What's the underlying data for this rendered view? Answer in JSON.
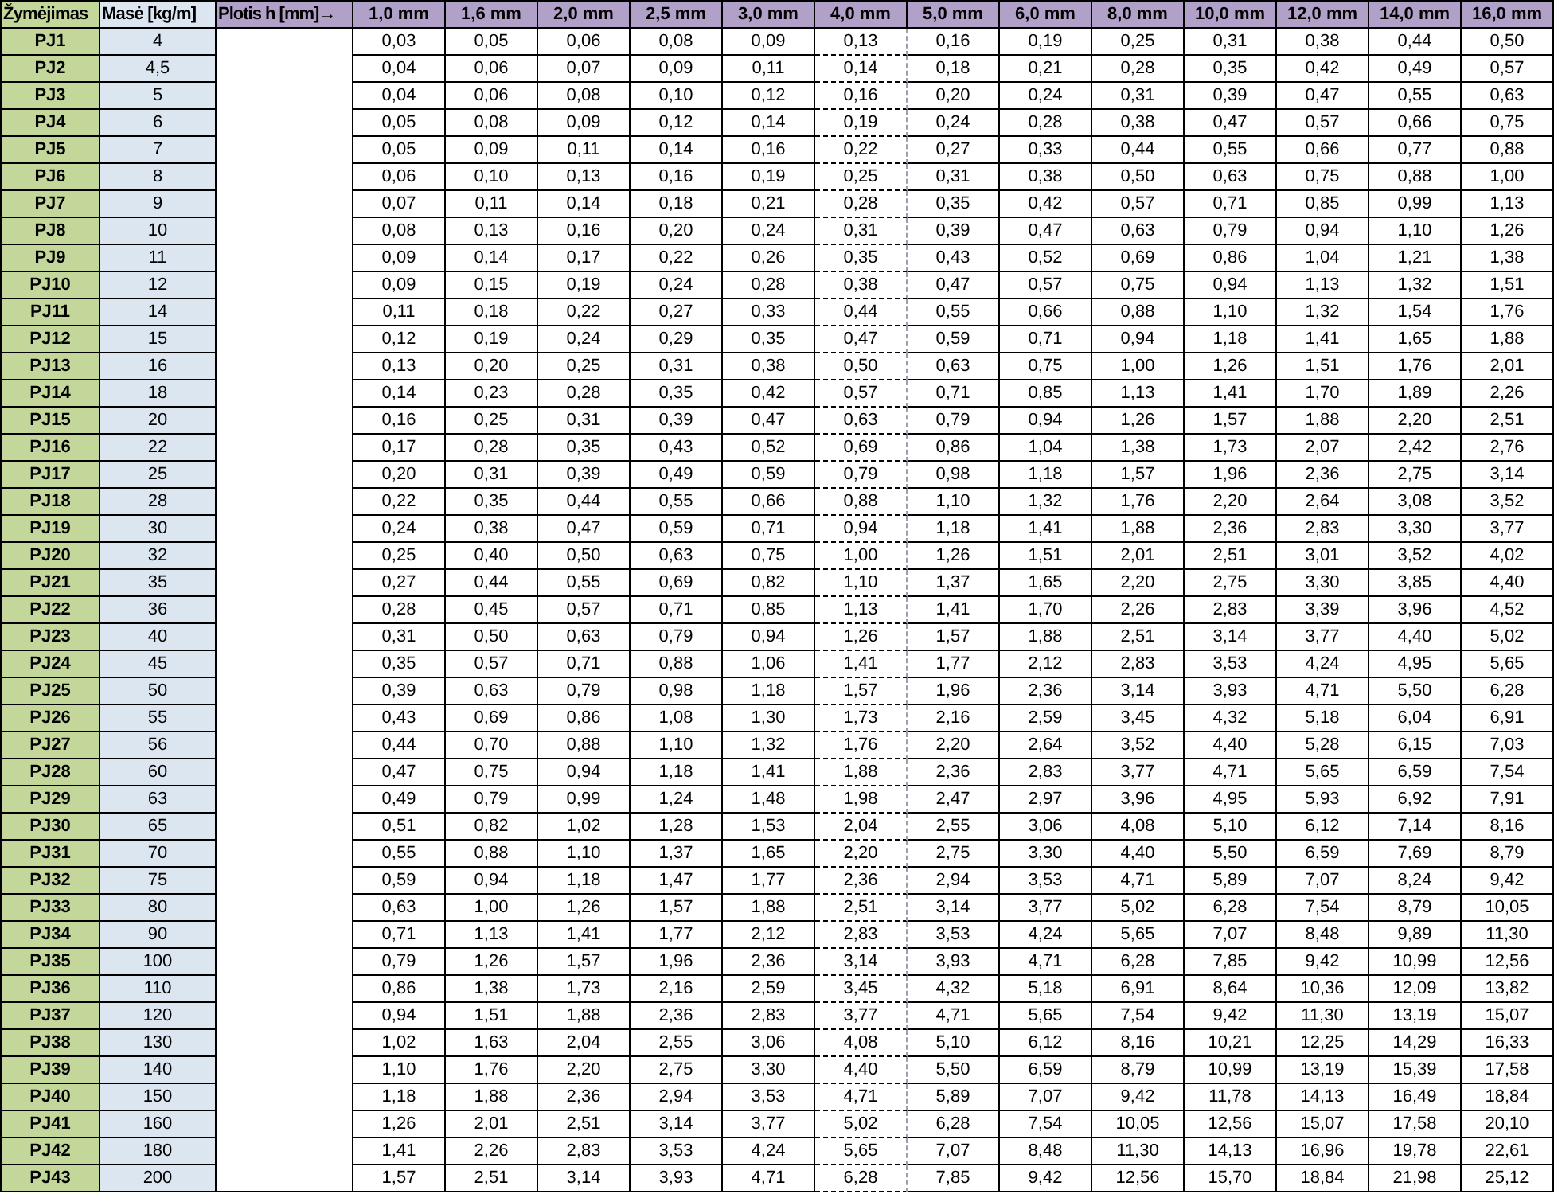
{
  "table": {
    "columns": [
      {
        "label": "Žymėjimas",
        "kind": "designation"
      },
      {
        "label": "Masė [kg/m]",
        "kind": "mass"
      },
      {
        "label": "Plotis h [mm]→",
        "kind": "width"
      },
      {
        "label": "1,0 mm",
        "kind": "thickness"
      },
      {
        "label": "1,6 mm",
        "kind": "thickness"
      },
      {
        "label": "2,0 mm",
        "kind": "thickness"
      },
      {
        "label": "2,5 mm",
        "kind": "thickness"
      },
      {
        "label": "3,0 mm",
        "kind": "thickness"
      },
      {
        "label": "4,0 mm",
        "kind": "thickness"
      },
      {
        "label": "5,0 mm",
        "kind": "thickness"
      },
      {
        "label": "6,0 mm",
        "kind": "thickness"
      },
      {
        "label": "8,0 mm",
        "kind": "thickness"
      },
      {
        "label": "10,0 mm",
        "kind": "thickness"
      },
      {
        "label": "12,0 mm",
        "kind": "thickness"
      },
      {
        "label": "14,0 mm",
        "kind": "thickness"
      },
      {
        "label": "16,0 mm",
        "kind": "thickness"
      }
    ],
    "rows": [
      [
        "PJ1",
        "4",
        "",
        "0,03",
        "0,05",
        "0,06",
        "0,08",
        "0,09",
        "0,13",
        "0,16",
        "0,19",
        "0,25",
        "0,31",
        "0,38",
        "0,44",
        "0,50"
      ],
      [
        "PJ2",
        "4,5",
        "",
        "0,04",
        "0,06",
        "0,07",
        "0,09",
        "0,11",
        "0,14",
        "0,18",
        "0,21",
        "0,28",
        "0,35",
        "0,42",
        "0,49",
        "0,57"
      ],
      [
        "PJ3",
        "5",
        "",
        "0,04",
        "0,06",
        "0,08",
        "0,10",
        "0,12",
        "0,16",
        "0,20",
        "0,24",
        "0,31",
        "0,39",
        "0,47",
        "0,55",
        "0,63"
      ],
      [
        "PJ4",
        "6",
        "",
        "0,05",
        "0,08",
        "0,09",
        "0,12",
        "0,14",
        "0,19",
        "0,24",
        "0,28",
        "0,38",
        "0,47",
        "0,57",
        "0,66",
        "0,75"
      ],
      [
        "PJ5",
        "7",
        "",
        "0,05",
        "0,09",
        "0,11",
        "0,14",
        "0,16",
        "0,22",
        "0,27",
        "0,33",
        "0,44",
        "0,55",
        "0,66",
        "0,77",
        "0,88"
      ],
      [
        "PJ6",
        "8",
        "",
        "0,06",
        "0,10",
        "0,13",
        "0,16",
        "0,19",
        "0,25",
        "0,31",
        "0,38",
        "0,50",
        "0,63",
        "0,75",
        "0,88",
        "1,00"
      ],
      [
        "PJ7",
        "9",
        "",
        "0,07",
        "0,11",
        "0,14",
        "0,18",
        "0,21",
        "0,28",
        "0,35",
        "0,42",
        "0,57",
        "0,71",
        "0,85",
        "0,99",
        "1,13"
      ],
      [
        "PJ8",
        "10",
        "",
        "0,08",
        "0,13",
        "0,16",
        "0,20",
        "0,24",
        "0,31",
        "0,39",
        "0,47",
        "0,63",
        "0,79",
        "0,94",
        "1,10",
        "1,26"
      ],
      [
        "PJ9",
        "11",
        "",
        "0,09",
        "0,14",
        "0,17",
        "0,22",
        "0,26",
        "0,35",
        "0,43",
        "0,52",
        "0,69",
        "0,86",
        "1,04",
        "1,21",
        "1,38"
      ],
      [
        "PJ10",
        "12",
        "",
        "0,09",
        "0,15",
        "0,19",
        "0,24",
        "0,28",
        "0,38",
        "0,47",
        "0,57",
        "0,75",
        "0,94",
        "1,13",
        "1,32",
        "1,51"
      ],
      [
        "PJ11",
        "14",
        "",
        "0,11",
        "0,18",
        "0,22",
        "0,27",
        "0,33",
        "0,44",
        "0,55",
        "0,66",
        "0,88",
        "1,10",
        "1,32",
        "1,54",
        "1,76"
      ],
      [
        "PJ12",
        "15",
        "",
        "0,12",
        "0,19",
        "0,24",
        "0,29",
        "0,35",
        "0,47",
        "0,59",
        "0,71",
        "0,94",
        "1,18",
        "1,41",
        "1,65",
        "1,88"
      ],
      [
        "PJ13",
        "16",
        "",
        "0,13",
        "0,20",
        "0,25",
        "0,31",
        "0,38",
        "0,50",
        "0,63",
        "0,75",
        "1,00",
        "1,26",
        "1,51",
        "1,76",
        "2,01"
      ],
      [
        "PJ14",
        "18",
        "",
        "0,14",
        "0,23",
        "0,28",
        "0,35",
        "0,42",
        "0,57",
        "0,71",
        "0,85",
        "1,13",
        "1,41",
        "1,70",
        "1,89",
        "2,26"
      ],
      [
        "PJ15",
        "20",
        "",
        "0,16",
        "0,25",
        "0,31",
        "0,39",
        "0,47",
        "0,63",
        "0,79",
        "0,94",
        "1,26",
        "1,57",
        "1,88",
        "2,20",
        "2,51"
      ],
      [
        "PJ16",
        "22",
        "",
        "0,17",
        "0,28",
        "0,35",
        "0,43",
        "0,52",
        "0,69",
        "0,86",
        "1,04",
        "1,38",
        "1,73",
        "2,07",
        "2,42",
        "2,76"
      ],
      [
        "PJ17",
        "25",
        "",
        "0,20",
        "0,31",
        "0,39",
        "0,49",
        "0,59",
        "0,79",
        "0,98",
        "1,18",
        "1,57",
        "1,96",
        "2,36",
        "2,75",
        "3,14"
      ],
      [
        "PJ18",
        "28",
        "",
        "0,22",
        "0,35",
        "0,44",
        "0,55",
        "0,66",
        "0,88",
        "1,10",
        "1,32",
        "1,76",
        "2,20",
        "2,64",
        "3,08",
        "3,52"
      ],
      [
        "PJ19",
        "30",
        "",
        "0,24",
        "0,38",
        "0,47",
        "0,59",
        "0,71",
        "0,94",
        "1,18",
        "1,41",
        "1,88",
        "2,36",
        "2,83",
        "3,30",
        "3,77"
      ],
      [
        "PJ20",
        "32",
        "",
        "0,25",
        "0,40",
        "0,50",
        "0,63",
        "0,75",
        "1,00",
        "1,26",
        "1,51",
        "2,01",
        "2,51",
        "3,01",
        "3,52",
        "4,02"
      ],
      [
        "PJ21",
        "35",
        "",
        "0,27",
        "0,44",
        "0,55",
        "0,69",
        "0,82",
        "1,10",
        "1,37",
        "1,65",
        "2,20",
        "2,75",
        "3,30",
        "3,85",
        "4,40"
      ],
      [
        "PJ22",
        "36",
        "",
        "0,28",
        "0,45",
        "0,57",
        "0,71",
        "0,85",
        "1,13",
        "1,41",
        "1,70",
        "2,26",
        "2,83",
        "3,39",
        "3,96",
        "4,52"
      ],
      [
        "PJ23",
        "40",
        "",
        "0,31",
        "0,50",
        "0,63",
        "0,79",
        "0,94",
        "1,26",
        "1,57",
        "1,88",
        "2,51",
        "3,14",
        "3,77",
        "4,40",
        "5,02"
      ],
      [
        "PJ24",
        "45",
        "",
        "0,35",
        "0,57",
        "0,71",
        "0,88",
        "1,06",
        "1,41",
        "1,77",
        "2,12",
        "2,83",
        "3,53",
        "4,24",
        "4,95",
        "5,65"
      ],
      [
        "PJ25",
        "50",
        "",
        "0,39",
        "0,63",
        "0,79",
        "0,98",
        "1,18",
        "1,57",
        "1,96",
        "2,36",
        "3,14",
        "3,93",
        "4,71",
        "5,50",
        "6,28"
      ],
      [
        "PJ26",
        "55",
        "",
        "0,43",
        "0,69",
        "0,86",
        "1,08",
        "1,30",
        "1,73",
        "2,16",
        "2,59",
        "3,45",
        "4,32",
        "5,18",
        "6,04",
        "6,91"
      ],
      [
        "PJ27",
        "56",
        "",
        "0,44",
        "0,70",
        "0,88",
        "1,10",
        "1,32",
        "1,76",
        "2,20",
        "2,64",
        "3,52",
        "4,40",
        "5,28",
        "6,15",
        "7,03"
      ],
      [
        "PJ28",
        "60",
        "",
        "0,47",
        "0,75",
        "0,94",
        "1,18",
        "1,41",
        "1,88",
        "2,36",
        "2,83",
        "3,77",
        "4,71",
        "5,65",
        "6,59",
        "7,54"
      ],
      [
        "PJ29",
        "63",
        "",
        "0,49",
        "0,79",
        "0,99",
        "1,24",
        "1,48",
        "1,98",
        "2,47",
        "2,97",
        "3,96",
        "4,95",
        "5,93",
        "6,92",
        "7,91"
      ],
      [
        "PJ30",
        "65",
        "",
        "0,51",
        "0,82",
        "1,02",
        "1,28",
        "1,53",
        "2,04",
        "2,55",
        "3,06",
        "4,08",
        "5,10",
        "6,12",
        "7,14",
        "8,16"
      ],
      [
        "PJ31",
        "70",
        "",
        "0,55",
        "0,88",
        "1,10",
        "1,37",
        "1,65",
        "2,20",
        "2,75",
        "3,30",
        "4,40",
        "5,50",
        "6,59",
        "7,69",
        "8,79"
      ],
      [
        "PJ32",
        "75",
        "",
        "0,59",
        "0,94",
        "1,18",
        "1,47",
        "1,77",
        "2,36",
        "2,94",
        "3,53",
        "4,71",
        "5,89",
        "7,07",
        "8,24",
        "9,42"
      ],
      [
        "PJ33",
        "80",
        "",
        "0,63",
        "1,00",
        "1,26",
        "1,57",
        "1,88",
        "2,51",
        "3,14",
        "3,77",
        "5,02",
        "6,28",
        "7,54",
        "8,79",
        "10,05"
      ],
      [
        "PJ34",
        "90",
        "",
        "0,71",
        "1,13",
        "1,41",
        "1,77",
        "2,12",
        "2,83",
        "3,53",
        "4,24",
        "5,65",
        "7,07",
        "8,48",
        "9,89",
        "11,30"
      ],
      [
        "PJ35",
        "100",
        "",
        "0,79",
        "1,26",
        "1,57",
        "1,96",
        "2,36",
        "3,14",
        "3,93",
        "4,71",
        "6,28",
        "7,85",
        "9,42",
        "10,99",
        "12,56"
      ],
      [
        "PJ36",
        "110",
        "",
        "0,86",
        "1,38",
        "1,73",
        "2,16",
        "2,59",
        "3,45",
        "4,32",
        "5,18",
        "6,91",
        "8,64",
        "10,36",
        "12,09",
        "13,82"
      ],
      [
        "PJ37",
        "120",
        "",
        "0,94",
        "1,51",
        "1,88",
        "2,36",
        "2,83",
        "3,77",
        "4,71",
        "5,65",
        "7,54",
        "9,42",
        "11,30",
        "13,19",
        "15,07"
      ],
      [
        "PJ38",
        "130",
        "",
        "1,02",
        "1,63",
        "2,04",
        "2,55",
        "3,06",
        "4,08",
        "5,10",
        "6,12",
        "8,16",
        "10,21",
        "12,25",
        "14,29",
        "16,33"
      ],
      [
        "PJ39",
        "140",
        "",
        "1,10",
        "1,76",
        "2,20",
        "2,75",
        "3,30",
        "4,40",
        "5,50",
        "6,59",
        "8,79",
        "10,99",
        "13,19",
        "15,39",
        "17,58"
      ],
      [
        "PJ40",
        "150",
        "",
        "1,18",
        "1,88",
        "2,36",
        "2,94",
        "3,53",
        "4,71",
        "5,89",
        "7,07",
        "9,42",
        "11,78",
        "14,13",
        "16,49",
        "18,84"
      ],
      [
        "PJ41",
        "160",
        "",
        "1,26",
        "2,01",
        "2,51",
        "3,14",
        "3,77",
        "5,02",
        "6,28",
        "7,54",
        "10,05",
        "12,56",
        "15,07",
        "17,58",
        "20,10"
      ],
      [
        "PJ42",
        "180",
        "",
        "1,41",
        "2,26",
        "2,83",
        "3,53",
        "4,24",
        "5,65",
        "7,07",
        "8,48",
        "11,30",
        "14,13",
        "16,96",
        "19,78",
        "22,61"
      ],
      [
        "PJ43",
        "200",
        "",
        "1,57",
        "2,51",
        "3,14",
        "3,93",
        "4,71",
        "6,28",
        "7,85",
        "9,42",
        "12,56",
        "15,70",
        "18,84",
        "21,98",
        "25,12"
      ]
    ]
  }
}
